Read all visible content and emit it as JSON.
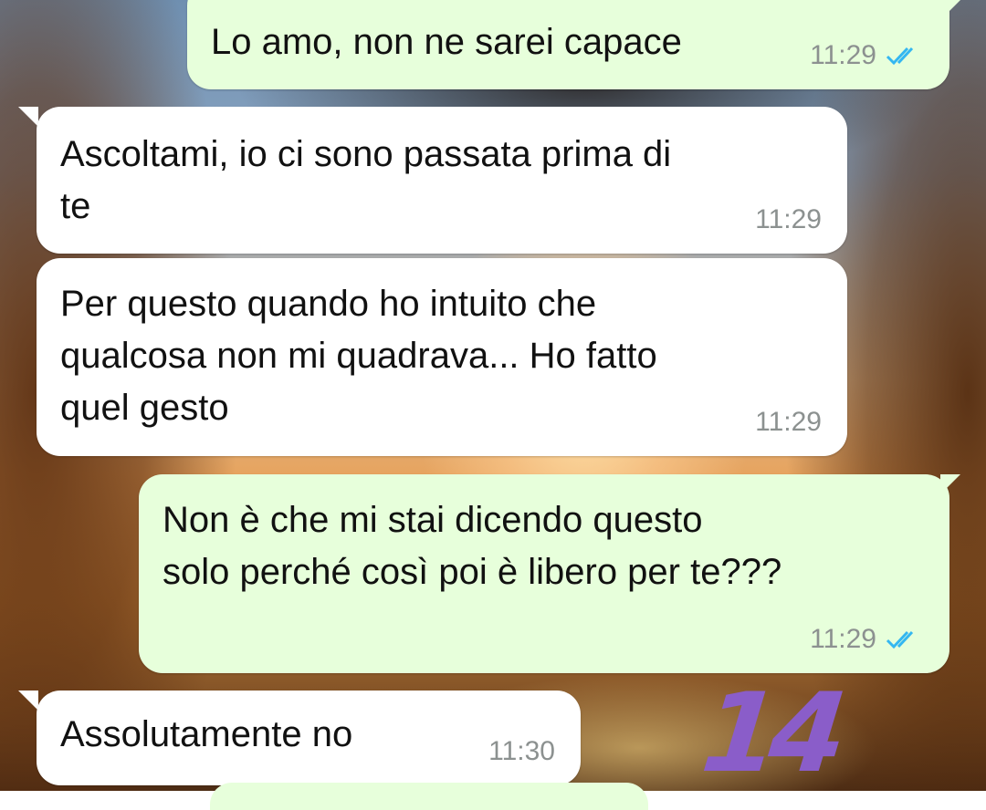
{
  "colors": {
    "outgoing_bubble": "#e7ffdb",
    "incoming_bubble": "#ffffff",
    "read_ticks": "#34b7f1",
    "time_text": "#8c9190",
    "sticker": "#8a5dc9"
  },
  "messages": [
    {
      "direction": "outgoing",
      "text": "Lo amo, non ne sarei capace",
      "time": "11:29",
      "status": "read",
      "status_icon": "double-check-icon"
    },
    {
      "direction": "incoming",
      "text": "Ascoltami, io ci sono passata prima di\nte",
      "time": "11:29"
    },
    {
      "direction": "incoming",
      "text": "Per questo quando ho intuito che\nqualcosa non mi quadrava... Ho fatto\nquel gesto",
      "time": "11:29"
    },
    {
      "direction": "outgoing",
      "text": "Non è che mi stai dicendo questo\nsolo perché così poi è libero per te???",
      "time": "11:29",
      "status": "read",
      "status_icon": "double-check-icon"
    },
    {
      "direction": "incoming",
      "text": "Assolutamente no",
      "time": "11:30"
    }
  ],
  "annotation": {
    "text": "14"
  }
}
